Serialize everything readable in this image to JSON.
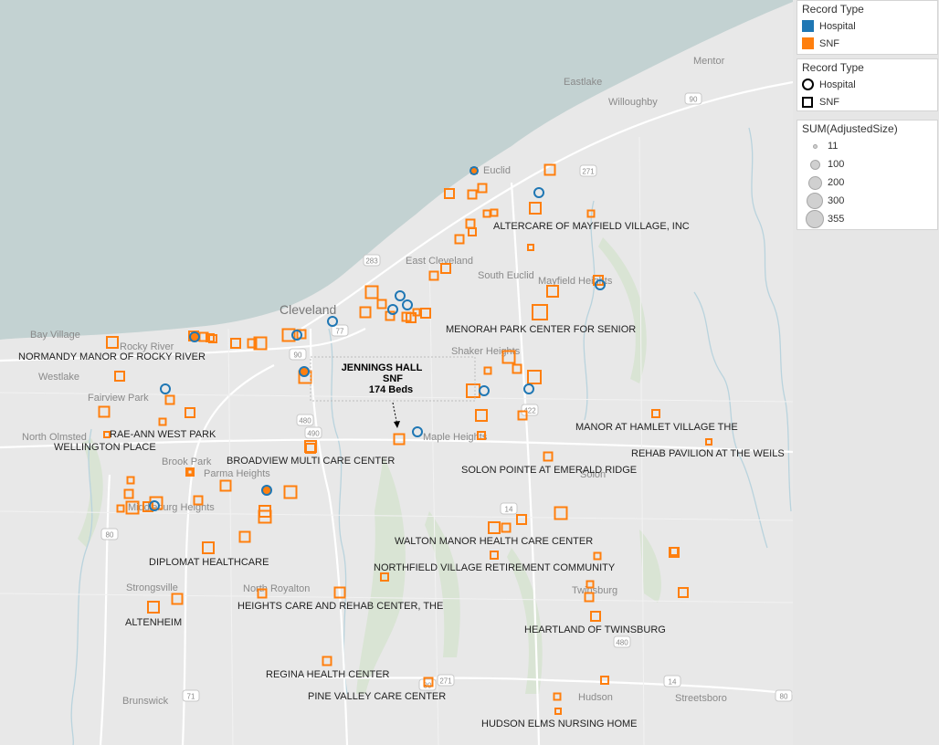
{
  "legend": {
    "color": {
      "title": "Record Type",
      "items": [
        {
          "label": "Hospital",
          "color": "#1f77b4"
        },
        {
          "label": "SNF",
          "color": "#ff7f0e"
        }
      ]
    },
    "shape": {
      "title": "Record Type",
      "items": [
        {
          "label": "Hospital",
          "shape": "circle"
        },
        {
          "label": "SNF",
          "shape": "square"
        }
      ]
    },
    "size": {
      "title": "SUM(AdjustedSize)",
      "items": [
        "11",
        "100",
        "200",
        "300",
        "355"
      ]
    }
  },
  "map": {
    "water_color": "#c3d2d2",
    "land_color": "#e8e8e8",
    "place_labels": [
      "Mentor",
      "Eastlake",
      "Willoughby",
      "Euclid",
      "East Cleveland",
      "South Euclid",
      "Mayfield Heights",
      "Cleveland",
      "Bay Village",
      "Rocky River",
      "Westlake",
      "Shaker Heights",
      "Fairview Park",
      "North Olmsted",
      "Maple Heights",
      "Brook Park",
      "Parma Heights",
      "Middleburg Heights",
      "Solon",
      "Strongsville",
      "North Royalton",
      "Twinsburg",
      "Hudson",
      "Streetsboro",
      "Brunswick"
    ],
    "road_shields": [
      "90",
      "271",
      "283",
      "77",
      "490",
      "480",
      "422",
      "14",
      "80",
      "71",
      "480",
      "271",
      "80",
      "14",
      "80",
      "90"
    ]
  },
  "tooltip": {
    "name": "JENNINGS HALL",
    "type": "SNF",
    "beds": "174 Beds"
  },
  "facility_labels": [
    "ALTERCARE OF MAYFIELD VILLAGE, INC",
    "MENORAH PARK CENTER FOR SENIOR",
    "NORMANDY MANOR OF ROCKY RIVER",
    "RAE-ANN WEST PARK",
    "WELLINGTON PLACE",
    "BROADVIEW MULTI CARE CENTER",
    "MANOR AT HAMLET VILLAGE THE",
    "REHAB PAVILION AT THE WEILS",
    "SOLON POINTE AT EMERALD RIDGE",
    "WALTON MANOR HEALTH CARE CENTER",
    "NORTHFIELD VILLAGE RETIREMENT COMMUNITY",
    "DIPLOMAT HEALTHCARE",
    "HEIGHTS CARE AND REHAB CENTER, THE",
    "HEARTLAND OF TWINSBURG",
    "ALTENHEIM",
    "REGINA HEALTH CENTER",
    "PINE VALLEY CARE CENTER",
    "HUDSON ELMS NURSING HOME"
  ]
}
